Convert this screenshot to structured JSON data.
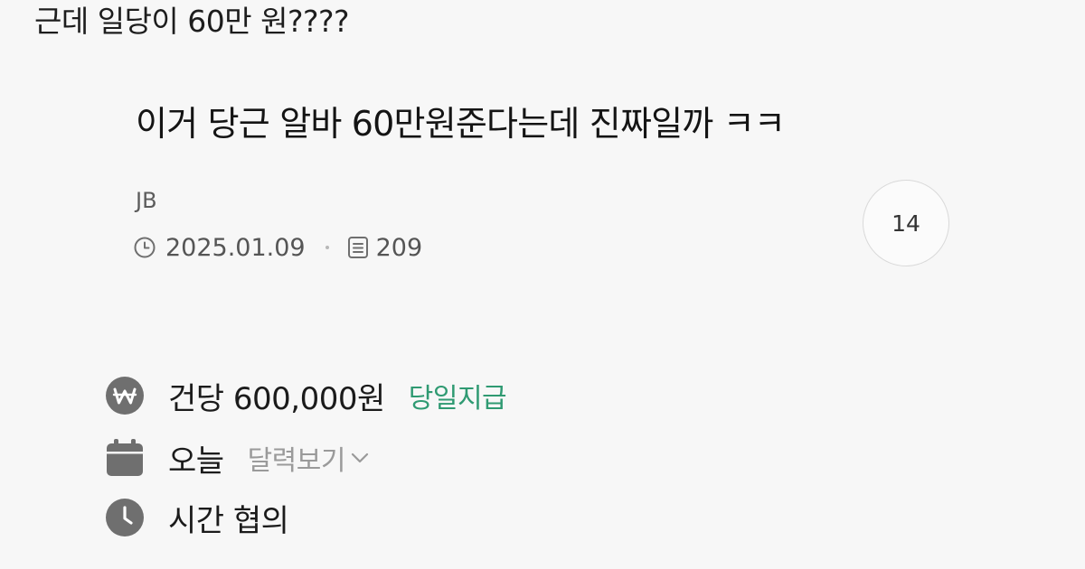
{
  "caption": {
    "text": "근데 일당이 60만 원????"
  },
  "post": {
    "title": "이거 당근 알바 60만원준다는데 진짜일까 ㅋㅋ",
    "author": "JB",
    "date": "2025.01.09",
    "views": "209",
    "comment_count": "14"
  },
  "job_details": {
    "pay": {
      "amount": "건당 600,000원",
      "badge": "당일지급"
    },
    "date": {
      "value": "오늘",
      "calendar_link": "달력보기"
    },
    "time": {
      "value": "시간 협의"
    }
  },
  "colors": {
    "accent_green": "#2f9a72",
    "icon_gray": "#6f6f6f",
    "muted_text": "#9a9a9a"
  },
  "icons": [
    "clock-icon",
    "document-icon",
    "won-icon",
    "calendar-icon",
    "clock-filled-icon",
    "chevron-down-icon"
  ]
}
